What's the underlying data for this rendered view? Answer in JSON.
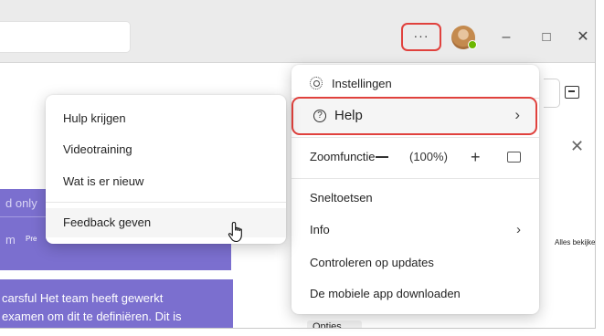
{
  "titlebar": {
    "more_label": "···",
    "minimize_label": "–",
    "maximize_label": "□",
    "close_label": "✕"
  },
  "content": {
    "band1_line1": "d only",
    "band1_line2": "m",
    "band1_pre": "Pre",
    "band2_line1": "carsful Het team heeft gewerkt",
    "band2_line2": "examen om dit te definiëren. Dit is",
    "alles_bekijken": "Alles bekijken",
    "opties": "Opties",
    "panel_close": "✕"
  },
  "menu": {
    "settings": "Instellingen",
    "help": "Help",
    "zoom_label": "Zoomfunctie",
    "zoom_level": "(100%)",
    "zoom_in": "+",
    "shortcuts": "Sneltoetsen",
    "info": "Info",
    "check_updates": "Controleren op updates",
    "mobile_app": "De mobiele app downloaden",
    "chevron": "›"
  },
  "help_submenu": {
    "get_help": "Hulp krijgen",
    "video_training": "Videotraining",
    "whats_new": "Wat is er nieuw",
    "feedback": "Feedback geven"
  },
  "colors": {
    "highlight_red": "#e0413d",
    "purple_band": "#7b6fcf",
    "presence_green": "#6bb700"
  }
}
